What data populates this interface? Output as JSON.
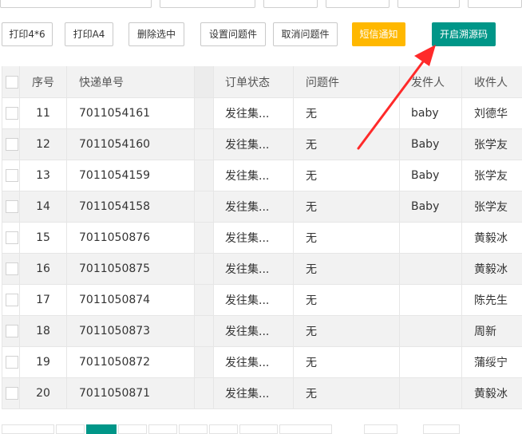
{
  "toolbar": {
    "print46": "打印4*6",
    "printA4": "打印A4",
    "delete_selected": "删除选中",
    "set_problem": "设置问题件",
    "cancel_problem": "取消问题件",
    "sms_notify": "短信通知",
    "open_trace": "开启溯源码"
  },
  "table": {
    "headers": {
      "seq": "序号",
      "tracking_no": "快递单号",
      "status": "订单状态",
      "problem": "问题件",
      "sender": "发件人",
      "receiver": "收件人"
    },
    "rows": [
      {
        "seq": "11",
        "tracking_no": "7011054161",
        "status": "发往集...",
        "problem": "无",
        "sender": "baby",
        "receiver": "刘德华"
      },
      {
        "seq": "12",
        "tracking_no": "7011054160",
        "status": "发往集...",
        "problem": "无",
        "sender": "Baby",
        "receiver": "张学友"
      },
      {
        "seq": "13",
        "tracking_no": "7011054159",
        "status": "发往集...",
        "problem": "无",
        "sender": "Baby",
        "receiver": "张学友"
      },
      {
        "seq": "14",
        "tracking_no": "7011054158",
        "status": "发往集...",
        "problem": "无",
        "sender": "Baby",
        "receiver": "张学友"
      },
      {
        "seq": "15",
        "tracking_no": "7011050876",
        "status": "发往集...",
        "problem": "无",
        "sender": "",
        "receiver": "黄毅冰"
      },
      {
        "seq": "16",
        "tracking_no": "7011050875",
        "status": "发往集...",
        "problem": "无",
        "sender": "",
        "receiver": "黄毅冰"
      },
      {
        "seq": "17",
        "tracking_no": "7011050874",
        "status": "发往集...",
        "problem": "无",
        "sender": "",
        "receiver": "陈先生"
      },
      {
        "seq": "18",
        "tracking_no": "7011050873",
        "status": "发往集...",
        "problem": "无",
        "sender": "",
        "receiver": "周新"
      },
      {
        "seq": "19",
        "tracking_no": "7011050872",
        "status": "发往集...",
        "problem": "无",
        "sender": "",
        "receiver": "蒲绥宁"
      },
      {
        "seq": "20",
        "tracking_no": "7011050871",
        "status": "发往集...",
        "problem": "无",
        "sender": "",
        "receiver": "黄毅冰"
      }
    ]
  },
  "colors": {
    "accent": "#009688",
    "warning": "#ffb800",
    "annotation_arrow": "#ff2a2a"
  }
}
